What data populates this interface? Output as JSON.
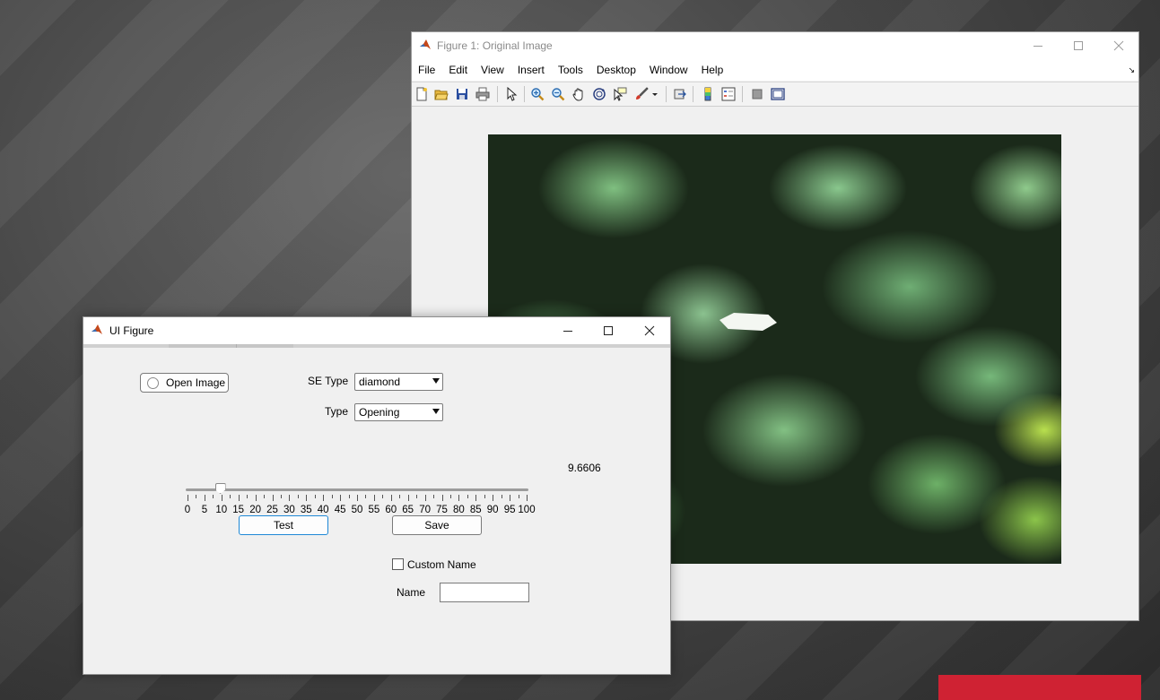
{
  "figure_window": {
    "title": "Figure 1: Original Image",
    "menu": [
      "File",
      "Edit",
      "View",
      "Insert",
      "Tools",
      "Desktop",
      "Window",
      "Help"
    ],
    "menu_overflow_icon": "dock-arrow-icon",
    "toolbar_icons": [
      "new-figure-icon",
      "open-file-icon",
      "save-icon",
      "print-icon",
      "pointer-icon",
      "zoom-in-icon",
      "zoom-out-icon",
      "pan-icon",
      "rotate-3d-icon",
      "data-cursor-icon",
      "brush-icon",
      "link-plot-icon",
      "colorbar-icon",
      "legend-icon",
      "hide-plot-tools-icon",
      "show-plot-tools-icon"
    ],
    "image": "green leaves photograph (artistic filter)"
  },
  "ui_figure": {
    "title": "UI Figure",
    "open_image_label": "Open Image",
    "se_type_label": "SE Type",
    "se_type_value": "diamond",
    "type_label": "Type",
    "type_value": "Opening",
    "slider": {
      "min": 0,
      "max": 100,
      "value": 9.6606,
      "value_text": "9.6606",
      "tick_labels": [
        "0",
        "5",
        "10",
        "15",
        "20",
        "25",
        "30",
        "35",
        "40",
        "45",
        "50",
        "55",
        "60",
        "65",
        "70",
        "75",
        "80",
        "85",
        "90",
        "95",
        "100"
      ]
    },
    "test_label": "Test",
    "save_label": "Save",
    "custom_name_label": "Custom Name",
    "custom_name_checked": false,
    "name_label": "Name",
    "name_value": ""
  },
  "colors": {
    "focus_border": "#1e88d6",
    "desktop_accent": "#cf2233"
  }
}
